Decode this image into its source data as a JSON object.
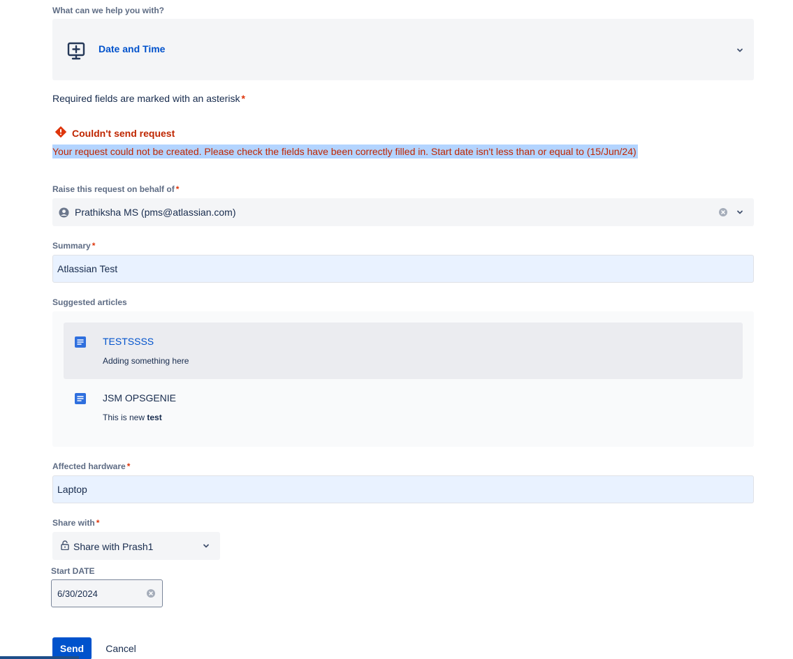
{
  "request_type": {
    "label": "What can we help you with?",
    "value": "Date and Time",
    "icon": "monitor-plus-icon"
  },
  "required_note": "Required fields are marked with an asterisk",
  "required_marker": "*",
  "error": {
    "title": "Couldn't send request",
    "message": "Your request could not be created. Please check the fields have been correctly filled in. Start date isn't less than or equal to (15/Jun/24)",
    "icon": "error-icon"
  },
  "on_behalf": {
    "label": "Raise this request on behalf of",
    "value": "Prathiksha MS (pms@atlassian.com)"
  },
  "summary": {
    "label": "Summary",
    "value": "Atlassian Test"
  },
  "suggested": {
    "label": "Suggested articles",
    "items": [
      {
        "title": "TESTSSSS",
        "desc": "Adding something here",
        "desc_bold": ""
      },
      {
        "title": "JSM OPSGENIE",
        "desc": "This is new ",
        "desc_bold": "test"
      }
    ]
  },
  "hardware": {
    "label": "Affected hardware",
    "value": "Laptop"
  },
  "share": {
    "label": "Share with",
    "value": "Share with Prash1"
  },
  "start_date": {
    "label": "Start DATE",
    "value": "6/30/2024"
  },
  "actions": {
    "send": "Send",
    "cancel": "Cancel"
  },
  "colors": {
    "primary": "#0052cc",
    "error": "#bf2600",
    "required": "#de350b",
    "selection": "#b3d4ff"
  }
}
